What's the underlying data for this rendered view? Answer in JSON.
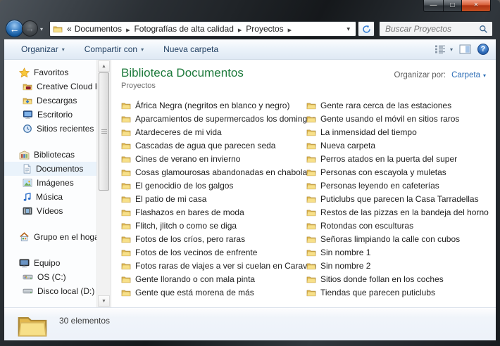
{
  "window": {
    "controls": [
      {
        "name": "minimize",
        "glyph": "—"
      },
      {
        "name": "maximize",
        "glyph": "□"
      },
      {
        "name": "close",
        "glyph": "×"
      }
    ]
  },
  "address_bar": {
    "collapsed_indicator": "«",
    "breadcrumbs": [
      "Documentos",
      "Fotografías de alta calidad",
      "Proyectos"
    ],
    "separator_glyph": "▶",
    "dropdown_glyph": "▾"
  },
  "search": {
    "placeholder": "Buscar Proyectos"
  },
  "toolbar": {
    "buttons": [
      {
        "label": "Organizar",
        "dropdown": true
      },
      {
        "label": "Compartir con",
        "dropdown": true
      },
      {
        "label": "Nueva carpeta",
        "dropdown": false
      }
    ]
  },
  "sidebar": {
    "sections": [
      {
        "label": "Favoritos",
        "icon": "star",
        "items": [
          {
            "label": "Creative Cloud Fil",
            "icon": "folder-cc"
          },
          {
            "label": "Descargas",
            "icon": "folder-download"
          },
          {
            "label": "Escritorio",
            "icon": "desktop"
          },
          {
            "label": "Sitios recientes",
            "icon": "recent-places"
          }
        ]
      },
      {
        "label": "Bibliotecas",
        "icon": "libraries",
        "items": [
          {
            "label": "Documentos",
            "icon": "library-documents",
            "selected": true
          },
          {
            "label": "Imágenes",
            "icon": "library-pictures"
          },
          {
            "label": "Música",
            "icon": "music-note"
          },
          {
            "label": "Vídeos",
            "icon": "film"
          }
        ]
      },
      {
        "label": "Grupo en el hogar",
        "icon": "homegroup",
        "items": []
      },
      {
        "label": "Equipo",
        "icon": "computer",
        "items": [
          {
            "label": "OS (C:)",
            "icon": "hdd-os"
          },
          {
            "label": "Disco local (D:)",
            "icon": "hdd"
          }
        ]
      }
    ]
  },
  "main": {
    "title": "Biblioteca Documentos",
    "subtitle": "Proyectos",
    "organize_by_label": "Organizar por:",
    "organize_by_value": "Carpeta",
    "columns": [
      [
        "África Negra (negritos en blanco y negro)",
        "Aparcamientos de supermercados los domingos",
        "Atardeceres de mi vida",
        "Cascadas de agua que parecen seda",
        "Cines de verano en invierno",
        "Cosas glamourosas abandonadas en chabolas",
        "El genocidio de los galgos",
        "El patio de mi casa",
        "Flashazos en bares de moda",
        "Flitch, jlitch o como se diga",
        "Fotos de los críos, pero raras",
        "Fotos de los vecinos de enfrente",
        "Fotos raras de viajes a ver si cuelan en Caravan",
        "Gente llorando o con mala pinta",
        "Gente que está morena de más"
      ],
      [
        "Gente rara cerca de las estaciones",
        "Gente usando el móvil en sitios raros",
        "La inmensidad del tiempo",
        "Nueva carpeta",
        "Perros atados en la puerta del super",
        "Personas con escayola y muletas",
        "Personas leyendo en cafeterías",
        "Puticlubs que parecen la Casa Tarradellas",
        "Restos de las pizzas en la bandeja del horno",
        "Rotondas con esculturas",
        "Señoras limpiando la calle con cubos",
        "Sin nombre 1",
        "Sin nombre 2",
        "Sitios donde follan en los coches",
        "Tiendas que parecen puticlubs"
      ]
    ]
  },
  "status_bar": {
    "text": "30 elementos"
  },
  "colors": {
    "title_green": "#1e7a3c",
    "link_blue": "#2b6cb5",
    "folder_yellow": "#f7e089",
    "close_button_red": "#b03312",
    "toolbar_text": "#1e3c5f"
  }
}
